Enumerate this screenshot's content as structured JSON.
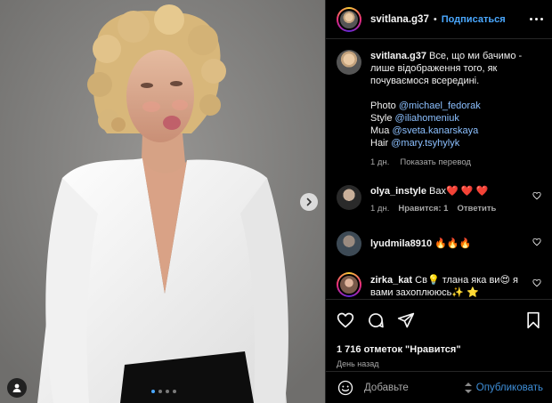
{
  "post": {
    "username": "svitlana.g37",
    "follow_label": "Подписаться",
    "separator": "•"
  },
  "caption": {
    "username": "svitlana.g37",
    "text": "Все, що ми бачимо - лише відображення того, як почуваємося всередині.",
    "credits": [
      {
        "label": "Photo",
        "handle": "@michael_fedorak"
      },
      {
        "label": "Style",
        "handle": "@iliahomeniuk"
      },
      {
        "label": "Mua",
        "handle": "@sveta.kanarskaya"
      },
      {
        "label": "Hair",
        "handle": "@mary.tsyhylyk"
      }
    ],
    "age": "1 дн.",
    "translate_label": "Показать перевод"
  },
  "comments": [
    {
      "username": "olya_instyle",
      "text": "Вах❤️ ❤️ ❤️",
      "age": "1 дн.",
      "likes_label": "Нравится: 1",
      "reply_label": "Ответить"
    },
    {
      "username": "lyudmila8910",
      "text": "🔥🔥🔥",
      "age": "",
      "likes_label": "",
      "reply_label": ""
    },
    {
      "username": "zirka_kat",
      "text": "Св💡 тлана яка ви😍 я вами захоплююсь✨ ⭐",
      "age": "",
      "likes_label": "",
      "reply_label": ""
    }
  ],
  "engagement": {
    "likes_text": "1 716 отметок \"Нравится\"",
    "date_text": "День назад"
  },
  "composer": {
    "placeholder": "Добавьте",
    "publish_label": "Опубликовать"
  },
  "carousel": {
    "slide_count": 4,
    "active_slide": 1
  },
  "colors": {
    "accent": "#4aa8ff",
    "link": "#8cc0ff",
    "background": "#000000",
    "muted": "#a8a8a8"
  },
  "icons": {
    "header_more": "more-horizontal-icon",
    "next": "chevron-right-icon",
    "like": "heart-icon",
    "comment": "comment-bubble-icon",
    "share": "paper-plane-icon",
    "save": "bookmark-icon",
    "emoji": "smiley-icon",
    "user_tag": "person-icon"
  }
}
